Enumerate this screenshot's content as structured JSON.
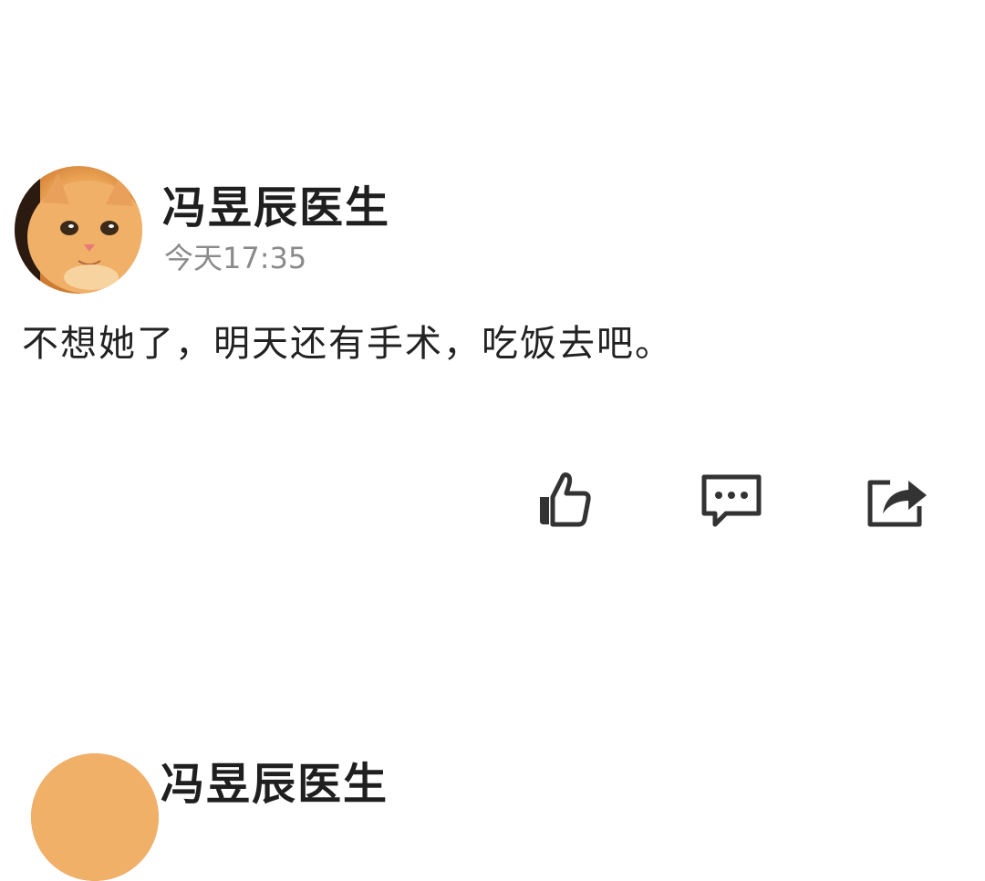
{
  "posts": [
    {
      "author": "冯昱辰医生",
      "time": "今天17:35",
      "text": "不想她了，明天还有手术，吃饭去吧。",
      "avatar_icon": "kitten-avatar"
    },
    {
      "author": "冯昱辰医生"
    }
  ],
  "actions": {
    "like_icon": "thumbs-up-icon",
    "comment_icon": "comment-icon",
    "share_icon": "share-icon"
  },
  "colors": {
    "name": "#1f1f1f",
    "time": "#8a8a8a",
    "text": "#222222",
    "icon": "#333333"
  }
}
